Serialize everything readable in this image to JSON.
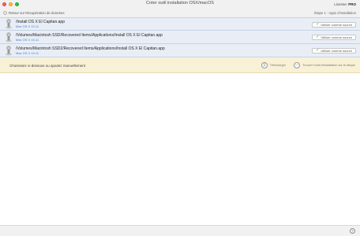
{
  "window": {
    "title": "Créer outil installation OSX/macOS",
    "license_label": "License:",
    "license_value": "PRO"
  },
  "toolbar": {
    "back_label": "Retour sur Récupération de données",
    "step": "Étape 1 : Apps d'Installation"
  },
  "sources": [
    {
      "path": "/Install OS X El Capitan.app",
      "version": "Mac OS X 10.11",
      "button": "Utiliser comme source"
    },
    {
      "path": "/Volumes/Macintosh SSD/Recovered Items/Applications/Install OS X El Capitan.app",
      "version": "Mac OS X 10.11",
      "button": "Utiliser comme source"
    },
    {
      "path": "/Volumes/Macintosh SSD2/Recovered Items/Applications/Install OS X El Capitan.app",
      "version": "Mac OS X 10.11",
      "button": "Utiliser comme source"
    }
  ],
  "banner": {
    "text": "Choisissez ci-dessous ou ajoutez manuellement",
    "download_label": "Télécharger",
    "find_label": "Trouver l'outil d'installation sur le disque"
  },
  "help": {
    "label": "?"
  },
  "colors": {
    "accent": "#3b7fd6",
    "banner_bg": "#f8f1d6",
    "row_bg": "#e9eef6"
  }
}
